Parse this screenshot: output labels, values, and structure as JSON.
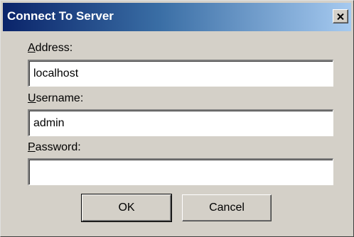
{
  "window": {
    "title": "Connect To Server",
    "close_icon": "close-x-icon"
  },
  "form": {
    "address": {
      "label_mnemonic": "A",
      "label_rest": "ddress:",
      "value": ""
    },
    "username": {
      "label_mnemonic": "U",
      "label_rest": "sername:",
      "value": ""
    },
    "password": {
      "label_mnemonic": "P",
      "label_rest": "assword:",
      "value": ""
    }
  },
  "buttons": {
    "ok_label": "OK",
    "cancel_label": "Cancel"
  },
  "field_values": {
    "address": "localhost",
    "username": "admin",
    "password": ""
  }
}
